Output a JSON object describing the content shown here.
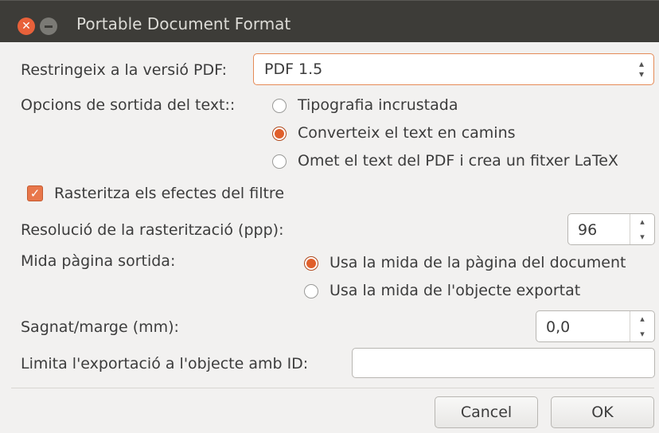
{
  "window": {
    "title": "Portable Document Format"
  },
  "pdf_version": {
    "label": "Restringeix a la versió PDF:",
    "value": "PDF 1.5"
  },
  "text_output": {
    "label": "Opcions de sortida del text::",
    "options": [
      "Tipografia incrustada",
      "Converteix el text en camins",
      "Omet el text del PDF i crea un fitxer LaTeX"
    ],
    "selected": "Converteix el text en camins"
  },
  "rasterize": {
    "label": "Rasteritza els efectes del filtre",
    "checked": true
  },
  "resolution": {
    "label": "Resolució de la rasterització (ppp):",
    "value": "96"
  },
  "page_size": {
    "label": "Mida pàgina sortida:",
    "options": [
      "Usa la mida de la pàgina del document",
      "Usa la mida de l'objecte exportat"
    ],
    "selected": "Usa la mida de la pàgina del document"
  },
  "bleed": {
    "label": "Sagnat/marge (mm):",
    "value": "0,0"
  },
  "limit_id": {
    "label": "Limita l'exportació a l'objecte amb ID:",
    "value": ""
  },
  "buttons": {
    "cancel": "Cancel",
    "ok": "OK"
  }
}
